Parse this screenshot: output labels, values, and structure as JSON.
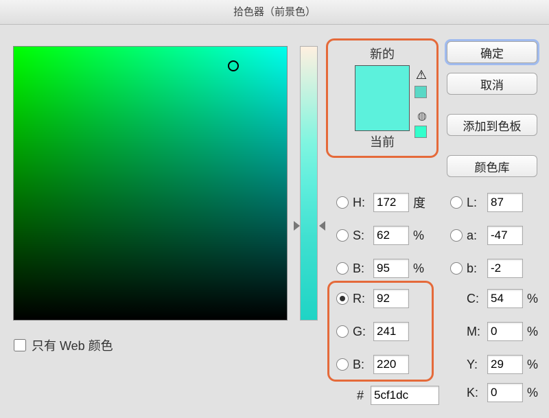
{
  "title": "拾色器（前景色）",
  "preview": {
    "new_label": "新的",
    "current_label": "当前",
    "new_color": "#5cf1dc",
    "current_color": "#5cf1dc"
  },
  "buttons": {
    "ok": "确定",
    "cancel": "取消",
    "add_swatches": "添加到色板",
    "color_libraries": "颜色库"
  },
  "webcolors_label": "只有 Web 颜色",
  "fields": {
    "H": {
      "label": "H:",
      "value": "172",
      "unit": "度"
    },
    "S": {
      "label": "S:",
      "value": "62",
      "unit": "%"
    },
    "Bv": {
      "label": "B:",
      "value": "95",
      "unit": "%"
    },
    "R": {
      "label": "R:",
      "value": "92"
    },
    "G": {
      "label": "G:",
      "value": "241"
    },
    "B": {
      "label": "B:",
      "value": "220"
    },
    "L": {
      "label": "L:",
      "value": "87"
    },
    "a": {
      "label": "a:",
      "value": "-47"
    },
    "b": {
      "label": "b:",
      "value": "-2"
    },
    "C": {
      "label": "C:",
      "value": "54",
      "unit": "%"
    },
    "M": {
      "label": "M:",
      "value": "0",
      "unit": "%"
    },
    "Y": {
      "label": "Y:",
      "value": "29",
      "unit": "%"
    },
    "K": {
      "label": "K:",
      "value": "0",
      "unit": "%"
    },
    "hex": {
      "label": "#",
      "value": "5cf1dc"
    }
  },
  "selected_radio": "R"
}
